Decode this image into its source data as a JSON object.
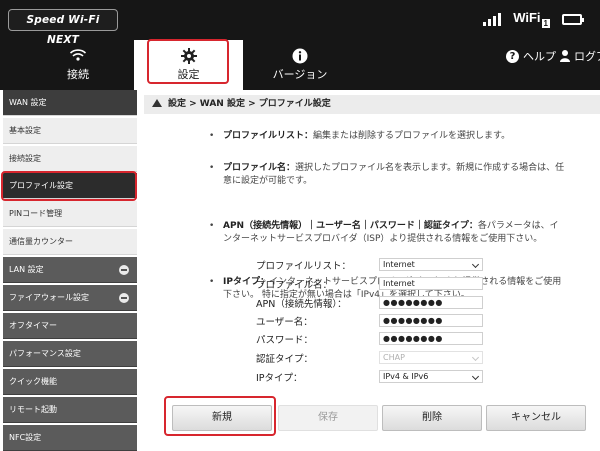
{
  "header": {
    "logo": "Speed Wi-Fi NEXT",
    "wifi": "WiFi",
    "wifi_badge": "1",
    "help": "ヘルプ",
    "login": "ログアウト"
  },
  "nav": {
    "tabs": [
      {
        "label": "接続",
        "icon": "globe-icon"
      },
      {
        "label": "設定",
        "icon": "gear-icon"
      },
      {
        "label": "バージョン",
        "icon": "info-icon"
      }
    ]
  },
  "sidebar": {
    "items": [
      {
        "label": "WAN 設定"
      },
      {
        "label": "基本設定"
      },
      {
        "label": "接続設定"
      },
      {
        "label": "プロファイル設定"
      },
      {
        "label": "PINコード管理"
      },
      {
        "label": "通信量カウンター"
      },
      {
        "label": "LAN 設定"
      },
      {
        "label": "ファイアウォール設定"
      },
      {
        "label": "オフタイマー"
      },
      {
        "label": "パフォーマンス設定"
      },
      {
        "label": "クイック機能"
      },
      {
        "label": "リモート起動"
      },
      {
        "label": "NFC設定"
      }
    ]
  },
  "breadcrumb": "設定 > WAN 設定 > プロファイル設定",
  "info": {
    "rows": [
      {
        "title": "プロファイルリスト：",
        "text": "編集または削除するプロファイルを選択します。"
      },
      {
        "title": "プロファイル名：",
        "text": "選択したプロファイル名を表示します。新規に作成する場合は、任意に設定が可能です。"
      },
      {
        "title": "APN（接続先情報）｜ユーザー名｜パスワード｜認証タイプ：",
        "text": "各パラメータは、インターネットサービスプロバイダ（ISP）より提供される情報をご使用下さい。"
      },
      {
        "title": "IPタイプ：",
        "text": "インターネットサービスプロバイダ（ISP）より提供される情報をご使用下さい。 特に指定が無い場合は「IPv4」を選択して下さい。"
      }
    ]
  },
  "form": {
    "profile_list": {
      "label": "プロファイルリスト：",
      "value": "Internet"
    },
    "profile_name": {
      "label": "プロファイル名：",
      "value": "Internet"
    },
    "apn": {
      "label": "APN（接続先情報）：",
      "value": "●●●●●●●●"
    },
    "username": {
      "label": "ユーザー名：",
      "value": "●●●●●●●●"
    },
    "password": {
      "label": "パスワード：",
      "value": "●●●●●●●●"
    },
    "auth_type": {
      "label": "認証タイプ：",
      "value": "CHAP"
    },
    "ip_type": {
      "label": "IPタイプ：",
      "value": "IPv4 & IPv6"
    }
  },
  "buttons": {
    "new": "新規",
    "save": "保存",
    "delete": "削除",
    "cancel": "キャンセル"
  },
  "colors": {
    "header_bg": "#161616",
    "highlight": "#d7262e"
  }
}
